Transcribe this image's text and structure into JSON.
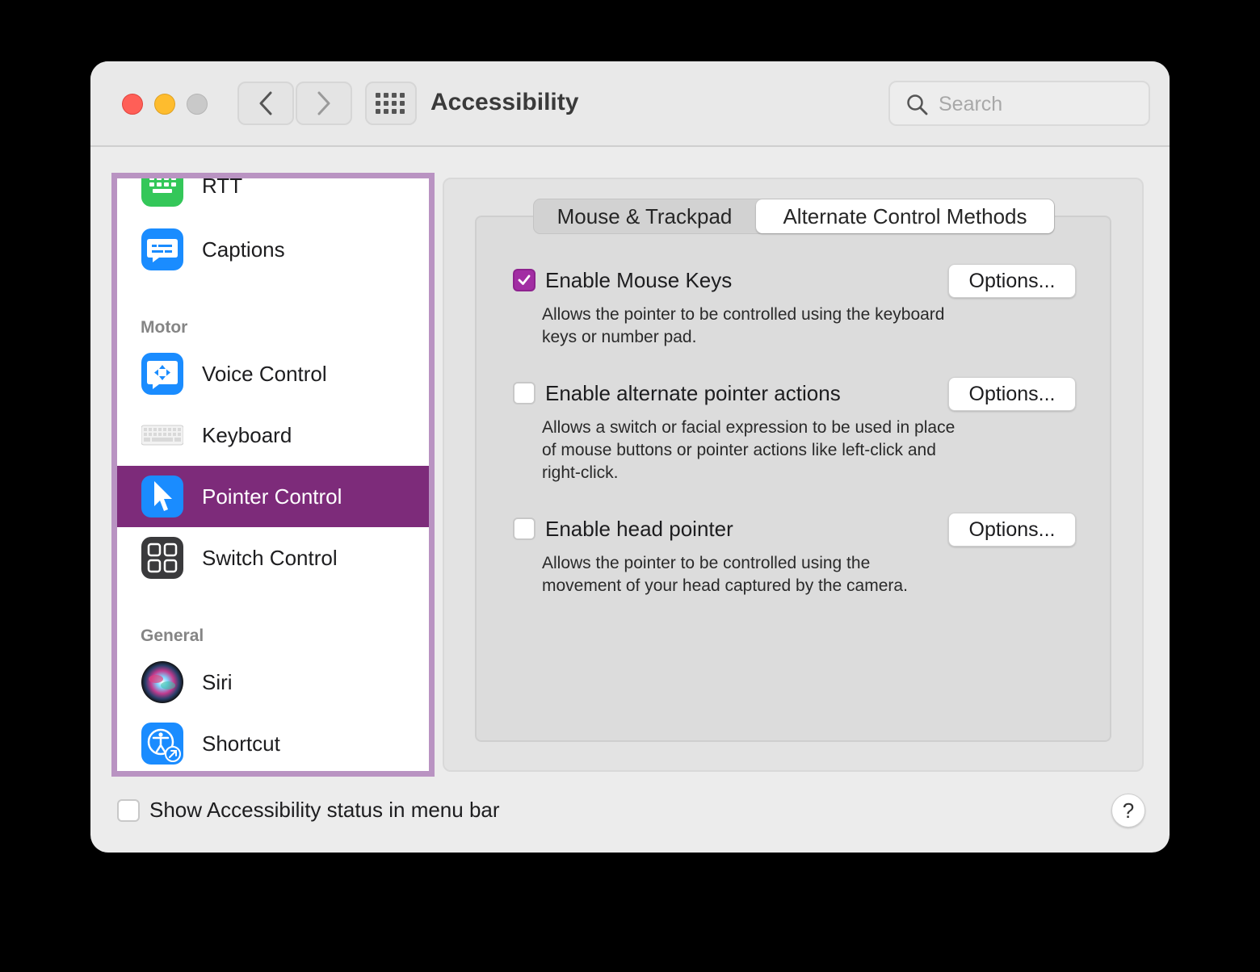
{
  "window": {
    "title": "Accessibility",
    "search_placeholder": "Search"
  },
  "sidebar": {
    "items": [
      {
        "label": "RTT",
        "icon": "rtt-keyboard-icon"
      },
      {
        "label": "Captions",
        "icon": "captions-icon"
      },
      {
        "label": "Voice Control",
        "icon": "voice-control-icon"
      },
      {
        "label": "Keyboard",
        "icon": "keyboard-icon"
      },
      {
        "label": "Pointer Control",
        "icon": "pointer-icon",
        "selected": true
      },
      {
        "label": "Switch Control",
        "icon": "switch-control-icon"
      },
      {
        "label": "Siri",
        "icon": "siri-icon"
      },
      {
        "label": "Shortcut",
        "icon": "accessibility-shortcut-icon"
      }
    ],
    "sections": {
      "motor": "Motor",
      "general": "General"
    }
  },
  "tabs": {
    "mouse_trackpad": "Mouse & Trackpad",
    "alternate": "Alternate Control Methods",
    "active": "Alternate Control Methods"
  },
  "options": [
    {
      "title": "Enable Mouse Keys",
      "checked": true,
      "description_lines": [
        "Allows the pointer to be controlled using the keyboard",
        "keys or number pad."
      ],
      "button": "Options..."
    },
    {
      "title": "Enable alternate pointer actions",
      "checked": false,
      "description_lines": [
        "Allows a switch or facial expression to be used in place",
        "of mouse buttons or pointer actions like left-click and",
        "right-click."
      ],
      "button": "Options..."
    },
    {
      "title": "Enable head pointer",
      "checked": false,
      "description_lines": [
        "Allows the pointer to be controlled using the",
        "movement of your head captured by the camera."
      ],
      "button": "Options..."
    }
  ],
  "footer": {
    "status_label": "Show Accessibility status in menu bar",
    "status_checked": false,
    "help": "?"
  },
  "colors": {
    "selected_row": "#7d2b7a",
    "sidebar_highlight_border": "#b993c2",
    "checkbox_accent": "#a22da3"
  }
}
